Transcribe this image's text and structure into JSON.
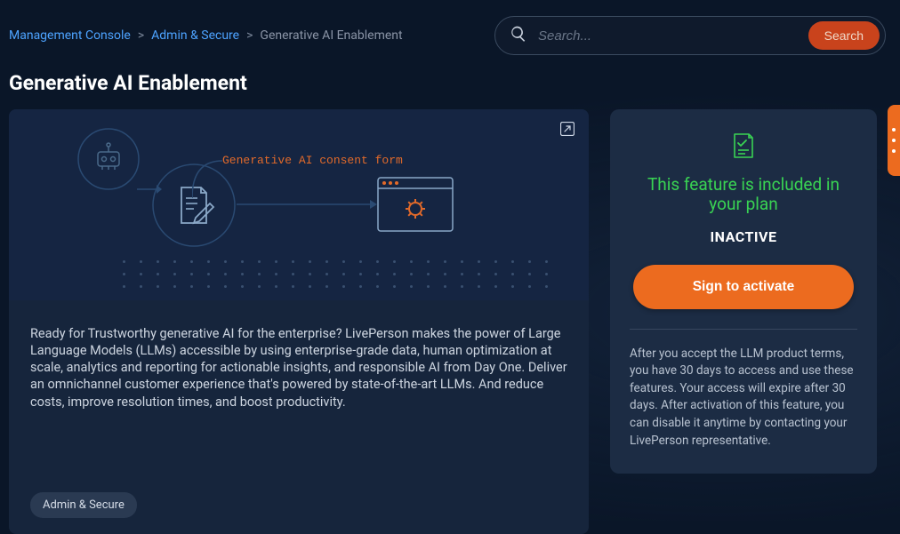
{
  "breadcrumb": {
    "root": "Management Console",
    "section": "Admin & Secure",
    "current": "Generative AI Enablement"
  },
  "search": {
    "placeholder": "Search...",
    "button": "Search"
  },
  "page": {
    "title": "Generative AI Enablement"
  },
  "illustration": {
    "label": "Generative AI consent form"
  },
  "main": {
    "description": "Ready for Trustworthy generative AI for the enterprise? LivePerson makes the power of Large Language Models (LLMs) accessible by using enterprise-grade data, human optimization at scale, analytics and reporting for actionable insights, and responsible AI from Day One. Deliver an omnichannel customer experience that's powered by state-of-the-art LLMs. And reduce costs, improve resolution times, and boost productivity.",
    "tag": "Admin & Secure"
  },
  "side": {
    "plan_line": "This feature is included in your plan",
    "status": "INACTIVE",
    "activate": "Sign to activate",
    "terms": "After you accept the LLM product terms, you have 30 days to access and use these features. Your access will expire after 30 days. After activation of this feature, you can disable it anytime by contacting your LivePerson representative."
  },
  "colors": {
    "accent": "#ec6b1f",
    "success": "#39d353",
    "link": "#4da3ff"
  }
}
